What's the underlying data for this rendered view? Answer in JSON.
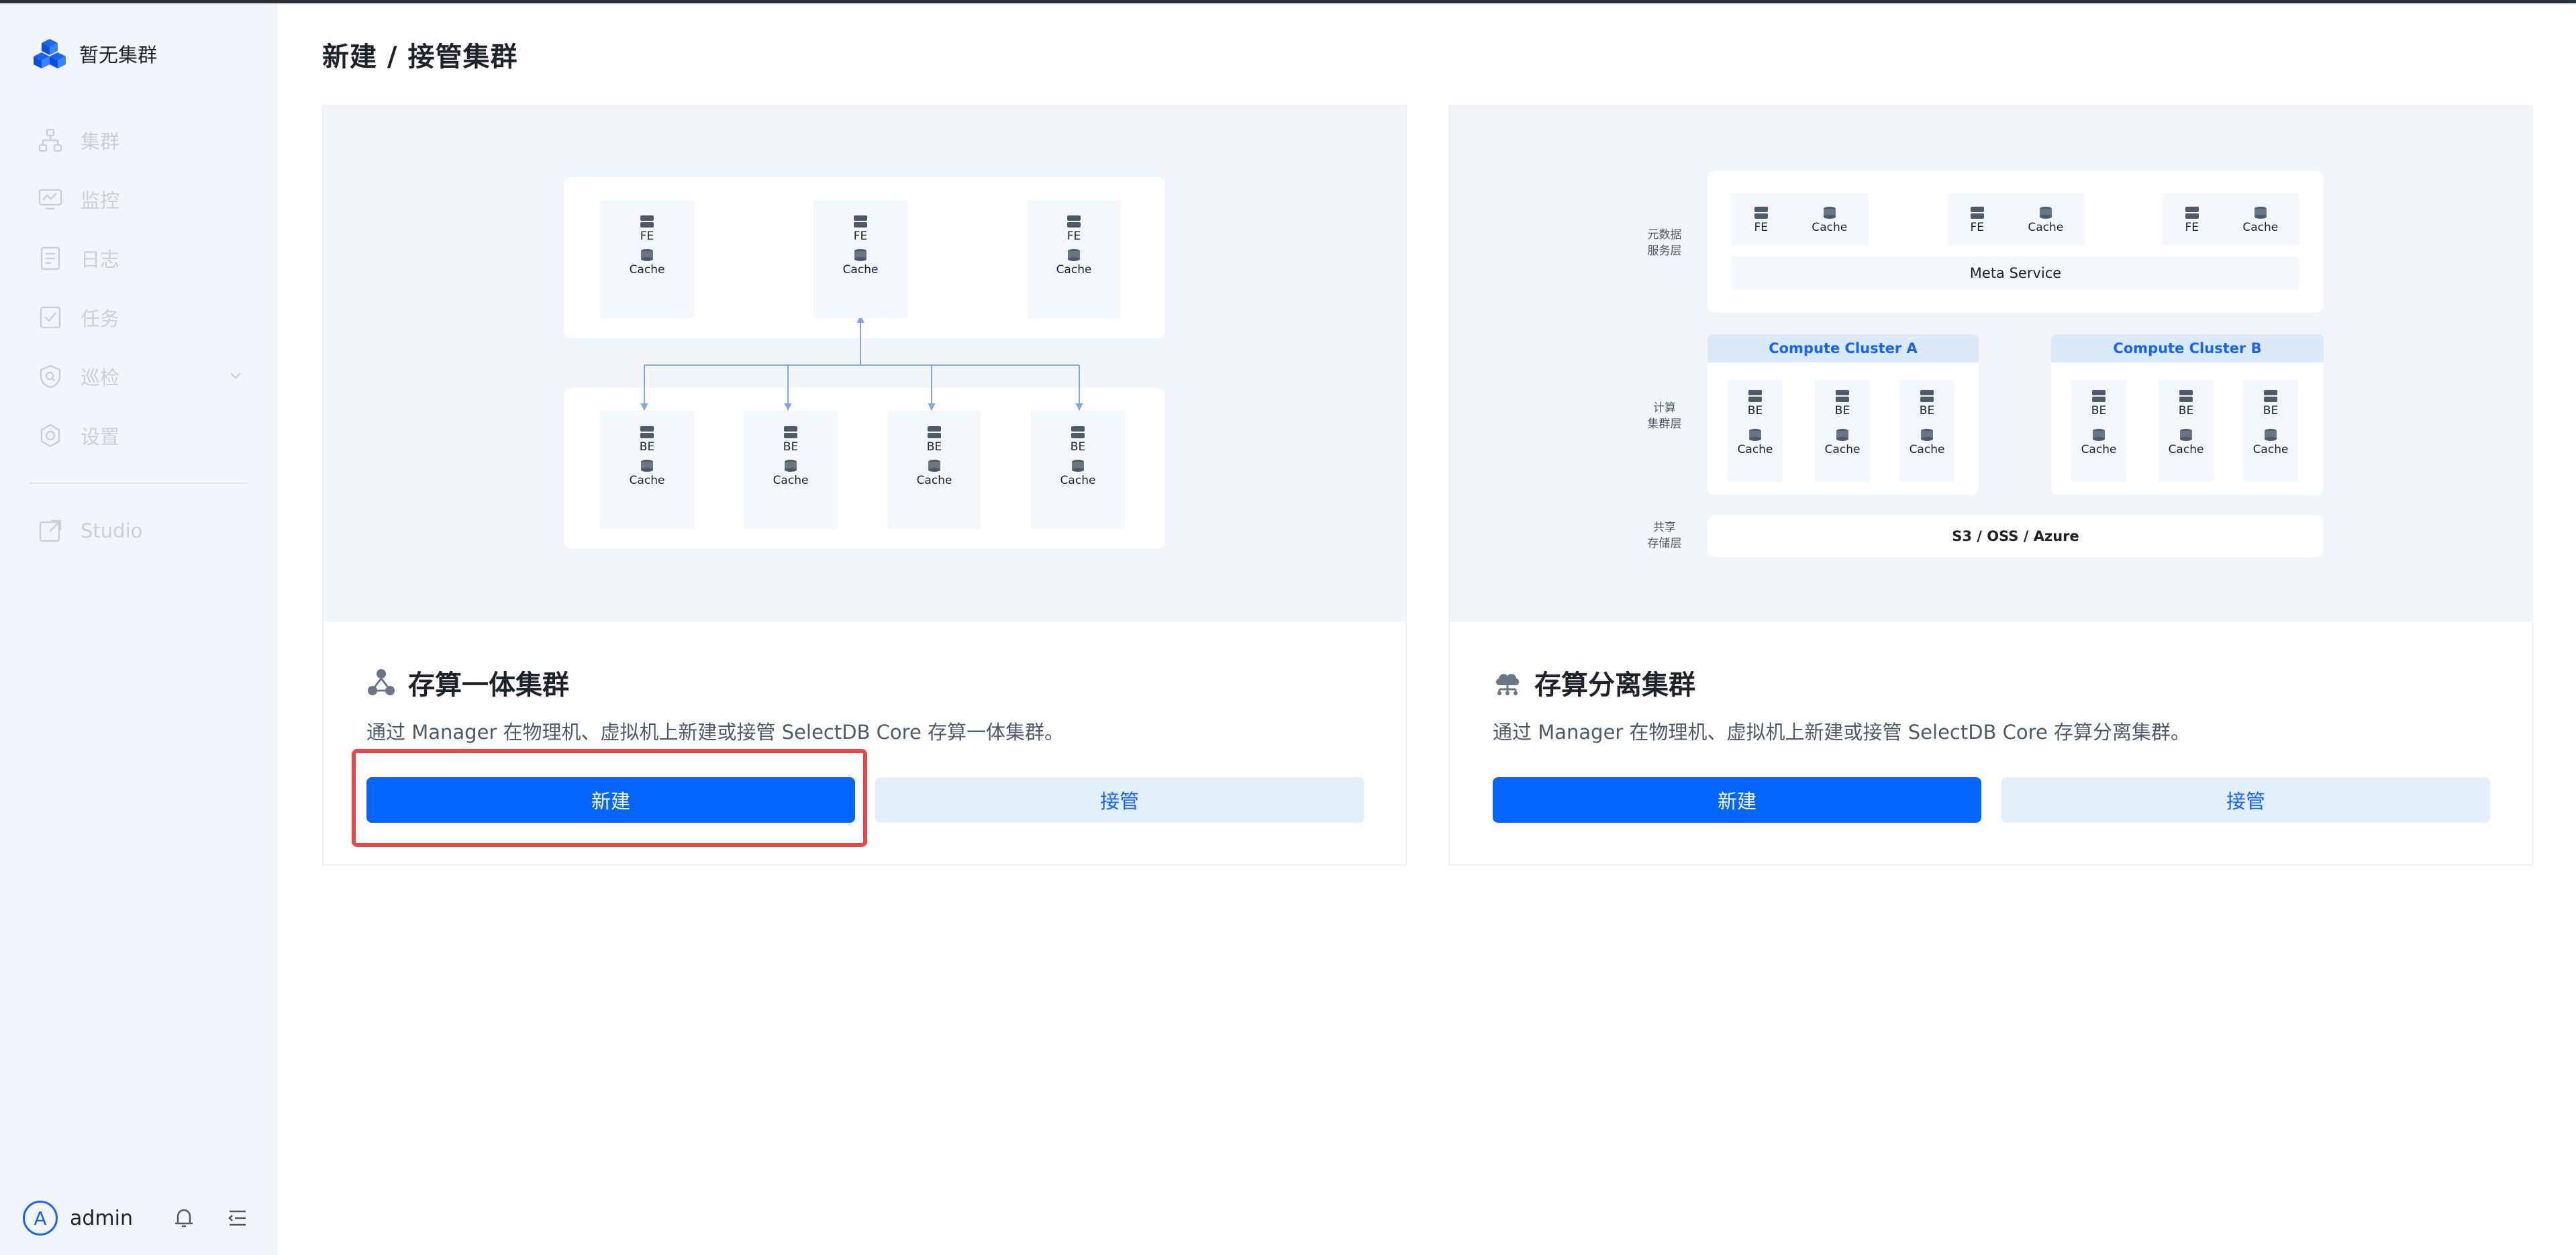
{
  "sidebar": {
    "brand": "暂无集群",
    "items": [
      {
        "label": "集群",
        "icon": "cluster-icon"
      },
      {
        "label": "监控",
        "icon": "monitor-icon"
      },
      {
        "label": "日志",
        "icon": "log-icon"
      },
      {
        "label": "任务",
        "icon": "task-icon"
      },
      {
        "label": "巡检",
        "icon": "inspect-icon"
      },
      {
        "label": "设置",
        "icon": "gear-icon"
      }
    ],
    "studio": "Studio",
    "user": {
      "avatar": "A",
      "name": "admin"
    }
  },
  "page": {
    "title": "新建 / 接管集群"
  },
  "cards": [
    {
      "title": "存算一体集群",
      "desc": "通过 Manager 在物理机、虚拟机上新建或接管 SelectDB Core 存算一体集群。",
      "create": "新建",
      "takeover": "接管"
    },
    {
      "title": "存算分离集群",
      "desc": "通过 Manager 在物理机、虚拟机上新建或接管 SelectDB Core 存算分离集群。",
      "create": "新建",
      "takeover": "接管"
    }
  ],
  "diagram_left": {
    "fe": "FE",
    "be": "BE",
    "cache": "Cache"
  },
  "diagram_right": {
    "meta_layer": "元数据\n服务层",
    "compute_layer": "计算\n集群层",
    "storage_layer": "共享\n存储层",
    "meta_service": "Meta Service",
    "cluster_a": "Compute Cluster A",
    "cluster_b": "Compute Cluster B",
    "storage": "S3 / OSS / Azure",
    "fe": "FE",
    "be": "BE",
    "cache": "Cache"
  },
  "colors": {
    "primary": "#0066ff",
    "secondary_bg": "#e3eefc",
    "highlight": "#e5484d",
    "sidebar_bg": "#f2f6fc"
  }
}
